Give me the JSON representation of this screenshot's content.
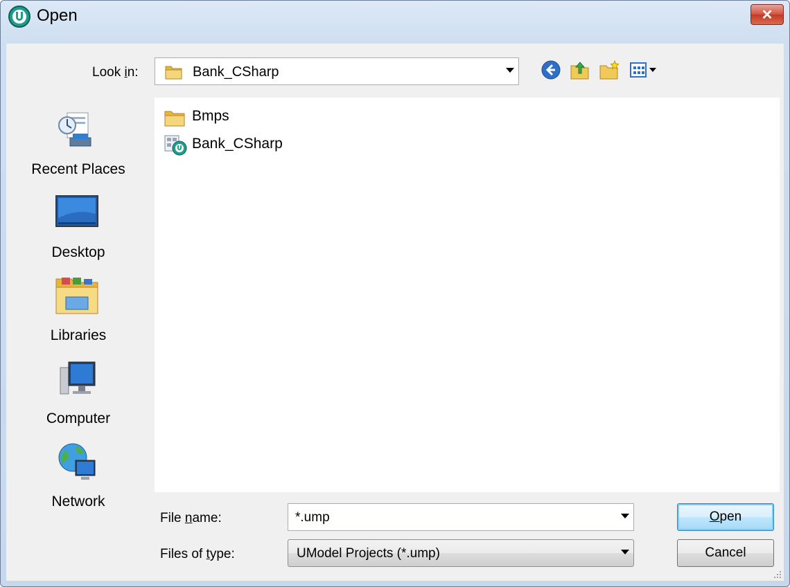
{
  "window": {
    "title": "Open",
    "close_symbol": "✕"
  },
  "lookin": {
    "label_pre": "Look ",
    "label_underlined": "i",
    "label_post": "n:",
    "value": "Bank_CSharp"
  },
  "toolbar": {
    "icons": [
      "back-icon",
      "up-folder-icon",
      "new-folder-icon",
      "view-menu-icon"
    ]
  },
  "places": [
    {
      "label": "Recent Places",
      "icon": "recent-places-icon"
    },
    {
      "label": "Desktop",
      "icon": "desktop-icon"
    },
    {
      "label": "Libraries",
      "icon": "libraries-icon"
    },
    {
      "label": "Computer",
      "icon": "computer-icon"
    },
    {
      "label": "Network",
      "icon": "network-icon"
    }
  ],
  "files": [
    {
      "name": "Bmps",
      "icon": "folder-icon"
    },
    {
      "name": "Bank_CSharp",
      "icon": "umodel-project-icon"
    }
  ],
  "filename": {
    "label_pre": "File ",
    "label_underlined": "n",
    "label_post": "ame:",
    "value": "*.ump"
  },
  "filetype": {
    "label_pre": "Files of ",
    "label_underlined": "t",
    "label_post": "ype:",
    "value": "UModel Projects (*.ump)"
  },
  "buttons": {
    "open_underlined": "O",
    "open_rest": "pen",
    "cancel": "Cancel"
  },
  "colors": {
    "titlebar": "#cfdff1",
    "close": "#c23a24",
    "accent": "#1e9c8e"
  }
}
